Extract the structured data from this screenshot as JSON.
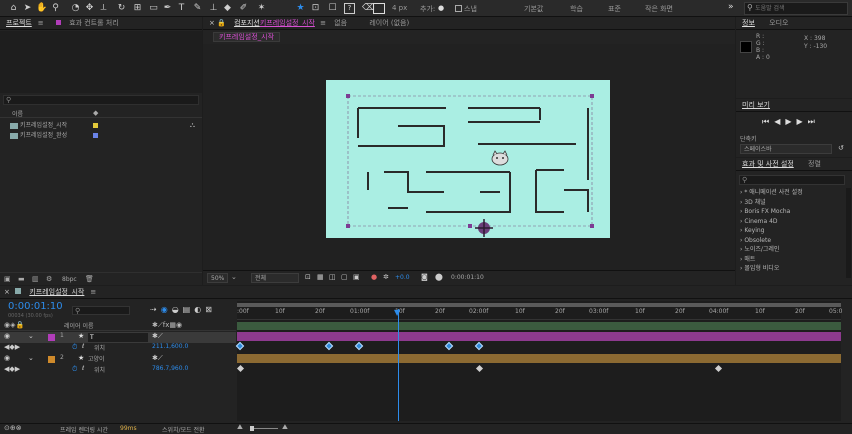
{
  "toolbar": {
    "tools": [
      "home-icon",
      "arrow-icon",
      "hand-icon",
      "zoom-icon",
      "orbit-icon",
      "move-icon",
      "rotate-icon",
      "rect-icon",
      "pen-icon",
      "text-icon",
      "brush-icon",
      "stamp-icon",
      "eraser-icon",
      "roto-icon",
      "puppet-icon"
    ],
    "snap_label": "4 px",
    "add_label": "추가:",
    "snap_check": "스냅",
    "default_label": "기본값",
    "learn": "학습",
    "standard": "표준",
    "small_screen": "작은 화면",
    "search_placeholder": "도움말 검색",
    "overflow": "»"
  },
  "project": {
    "tab": "프로젝트",
    "tab_menu": "≡",
    "effects_tab": "효과 컨트롤 처리",
    "search_placeholder": "",
    "col_name": "이름",
    "items": [
      {
        "name": "키프레임설정_시작",
        "color": "#e2c93a"
      },
      {
        "name": "키프레임설정_완성",
        "color": "#6a83e8"
      }
    ],
    "bpc": "8bpc"
  },
  "comp": {
    "tab_prefix": "컴포지션",
    "tab_name": "키프레임설정_시작",
    "menu": "≡",
    "lock_icon": "lock-icon",
    "lang_label": "없음",
    "layer_label": "레이어 (없음)",
    "breadcrumb": "키프레임설정_시작",
    "zoom": "50%",
    "quality": "전체",
    "exposure": "+0.0",
    "timecode": "0:00:01:10",
    "bg_color": "#a8ece0",
    "wall_color": "#2a2a2a"
  },
  "info": {
    "tab": "정보",
    "audio_tab": "오디오",
    "r": "R :",
    "g": "G :",
    "b": "B :",
    "a": "A : 0",
    "x": "X : 398",
    "y": "Y : -130"
  },
  "preview": {
    "tab": "미리 보기",
    "shortcut_label": "단축키",
    "shortcut_value": "스페이스바"
  },
  "effects": {
    "tab": "효과 및 사전 설정",
    "tab2": "정렬",
    "search_placeholder": "",
    "items": [
      "* 애니메이션 사전 설정",
      "3D 채널",
      "Boris FX Mocha",
      "Cinema 4D",
      "Keying",
      "Obsolete",
      "노이즈/그레인",
      "매트",
      "몰입형 비디오"
    ]
  },
  "timeline": {
    "tab": "키프레임설정_시작",
    "menu": "≡",
    "timecode": "0:00:01:10",
    "fps": "00034 (30.00 fps)",
    "col_layer": "레이어 이름",
    "ruler": [
      ":00f",
      "10f",
      "20f",
      "01:00f",
      "10f",
      "20f",
      "02:00f",
      "10f",
      "20f",
      "03:00f",
      "10f",
      "20f",
      "04:00f",
      "10f",
      "20f",
      "05:0"
    ],
    "layers": [
      {
        "num": "1",
        "name": "T",
        "color": "#b13db9",
        "prop": "위치",
        "value": "211.1,600.0",
        "bar": "#8d3a8e"
      },
      {
        "num": "2",
        "name": "고양이",
        "color": "#cf8a2b",
        "prop": "위치",
        "value": "786.7,960.0",
        "bar": "#8c6a32"
      }
    ],
    "footer_label": "프레임 렌더링 시간",
    "footer_time": "99ms",
    "footer_toggle": "스위치/모드 전환"
  }
}
